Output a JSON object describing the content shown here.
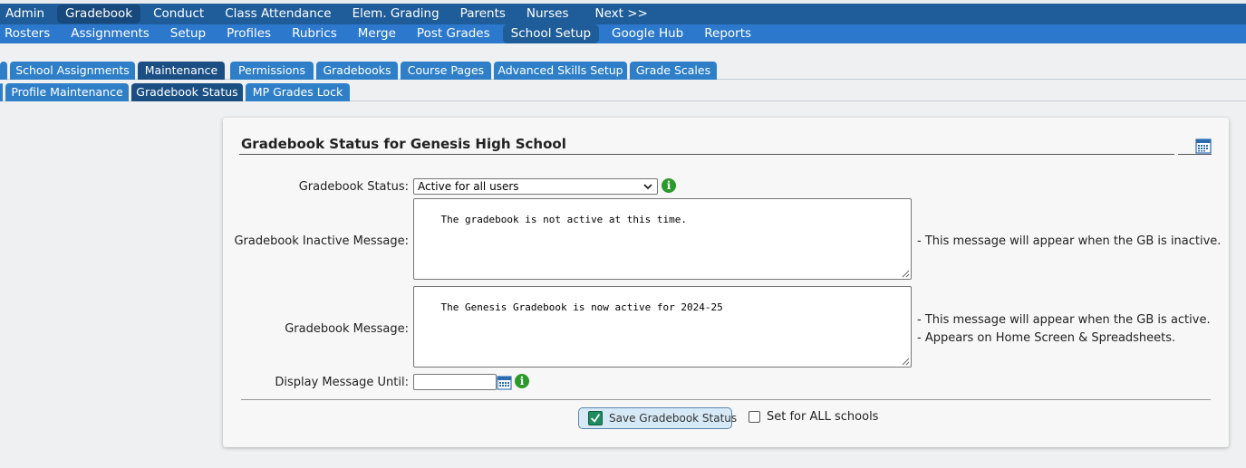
{
  "nav_main": {
    "items": [
      "Admin",
      "Gradebook",
      "Conduct",
      "Class Attendance",
      "Elem. Grading",
      "Parents",
      "Nurses",
      "Next >>"
    ],
    "active": "Gradebook"
  },
  "nav_sub": {
    "items": [
      "Rosters",
      "Assignments",
      "Setup",
      "Profiles",
      "Rubrics",
      "Merge",
      "Post Grades",
      "School Setup",
      "Google Hub",
      "Reports"
    ],
    "active": "School Setup"
  },
  "tabs_row1": {
    "items": [
      "School Assignments",
      "Maintenance",
      "Permissions",
      "Gradebooks",
      "Course Pages",
      "Advanced Skills Setup",
      "Grade Scales"
    ],
    "active": "Maintenance"
  },
  "tabs_row2": {
    "items": [
      "Profile Maintenance",
      "Gradebook Status",
      "MP Grades Lock"
    ],
    "active": "Gradebook Status"
  },
  "panel": {
    "title": "Gradebook Status for Genesis High School",
    "calendar_icon": "calendar-icon"
  },
  "form": {
    "status_label": "Gradebook Status:",
    "status_value": "Active for all users",
    "inactive_label": "Gradebook Inactive Message:",
    "inactive_value": "The gradebook is not active at this time.",
    "inactive_note": "- This message will appear when the GB is inactive.",
    "message_label": "Gradebook Message:",
    "message_value": "The Genesis Gradebook is now active for 2024-25",
    "message_note_1": "- This message will appear when the GB is active.",
    "message_note_2": "- Appears on Home Screen & Spreadsheets.",
    "display_until_label": "Display Message Until:",
    "display_until_value": "",
    "save_button": "Save Gradebook Status",
    "all_schools_label": "Set for ALL schools",
    "all_schools_checked": false
  },
  "colors": {
    "nav_main_bg": "#1f5d9a",
    "nav_sub_bg": "#2b78cc",
    "tab_bg": "#2f7fc8",
    "tab_active_bg": "#1b4f84",
    "info_green": "#2a9a2a"
  }
}
